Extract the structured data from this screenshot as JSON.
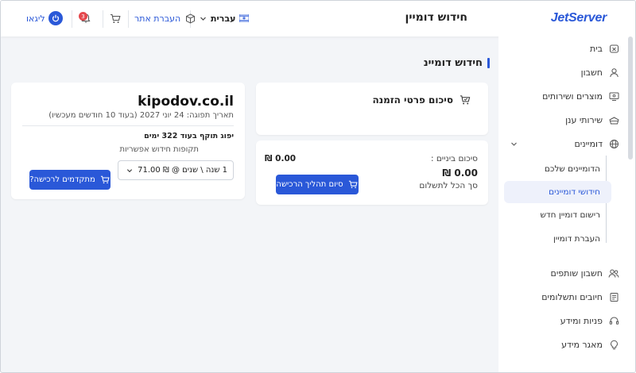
{
  "header": {
    "logo": "JetServer",
    "page_title": "חידוש דומיין",
    "language": "עברית",
    "transfer_label": "העברת אתר",
    "logout_label": "ליגאו",
    "notif_count": "3",
    "colors": {
      "accent": "#2a58d8",
      "badge": "#e5484d"
    }
  },
  "sidebar": {
    "items": [
      {
        "label": "בית",
        "icon": "home-icon"
      },
      {
        "label": "חשבון",
        "icon": "user-icon"
      },
      {
        "label": "מוצרים ושירותים",
        "icon": "monitor-icon"
      },
      {
        "label": "שירותי ענן",
        "icon": "cloud-icon"
      },
      {
        "label": "דומיינים",
        "icon": "globe-icon"
      }
    ],
    "domain_sub": [
      {
        "label": "הדומיינים שלכם"
      },
      {
        "label": "חידושי דומיינים"
      },
      {
        "label": "רישום דומיין חדש"
      },
      {
        "label": "העברת דומיין"
      }
    ],
    "bottom_items": [
      {
        "label": "חשבון שותפים",
        "icon": "partners-icon"
      },
      {
        "label": "חיובים ותשלומים",
        "icon": "invoice-icon"
      },
      {
        "label": "פניות ומידע",
        "icon": "headset-icon"
      },
      {
        "label": "מאגר מידע",
        "icon": "lightbulb-icon"
      }
    ]
  },
  "main": {
    "title": "חידוש דומיינ",
    "summary": {
      "title": "סיכום פרטי הזמנה",
      "subtotal_label": "סיכום ביניים :",
      "subtotal_value": "0.00 ₪",
      "total_value": "0.00 ₪",
      "total_label": "סך הכל לתשלום",
      "checkout_button": "סיום תהליך הרכישה"
    },
    "domain": {
      "name": "kipodov.co.il",
      "expiry": "תאריך תפוגה: 24 יוני 2027 (בעוד 10 חודשים מעכשיו)",
      "validity": "יפוג תוקף בעוד 322 ימים",
      "periods_label": "תקופות חידוש אפשריות",
      "selected_period": "1 שנה \\ שנים @ ₪ 71.00",
      "continue_button": "מתקדמים לרכישה?"
    }
  }
}
